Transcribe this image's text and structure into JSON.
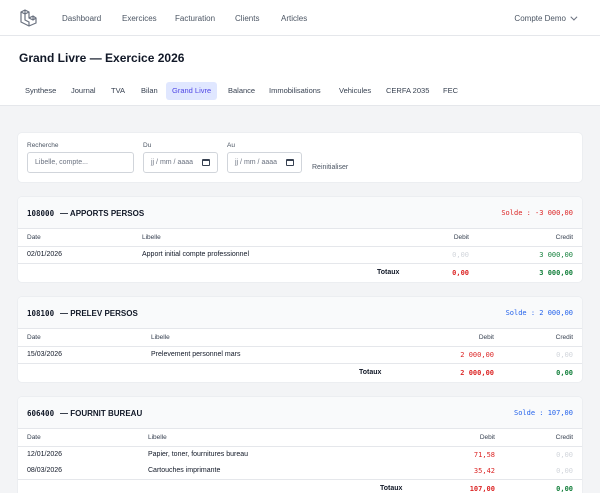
{
  "nav": {
    "items": [
      "Dashboard",
      "Exercices",
      "Facturation",
      "Clients",
      "Articles"
    ],
    "account_label": "Compte Demo"
  },
  "page": {
    "title": "Grand Livre — Exercice 2026"
  },
  "tabs": [
    "Synthese",
    "Journal",
    "TVA",
    "Bilan",
    "Grand Livre",
    "Balance",
    "Immobilisations",
    "Vehicules",
    "CERFA 2035",
    "FEC"
  ],
  "active_tab": "Grand Livre",
  "filters": {
    "search_label": "Recherche",
    "search_placeholder": "Libelle, compte...",
    "from_label": "Du",
    "from_value": "jj / mm / aaaa",
    "to_label": "Au",
    "to_value": "jj / mm / aaaa",
    "reset_label": "Reinitialiser"
  },
  "table_headers": {
    "date": "Date",
    "label": "Libelle",
    "debit": "Debit",
    "credit": "Credit",
    "totals": "Totaux"
  },
  "accounts": [
    {
      "code": "108000",
      "name": "— APPORTS PERSOS",
      "solde": "Solde : -3 000,00",
      "rows": [
        {
          "date": "02/01/2026",
          "label": "Apport initial compte professionnel",
          "debit": "0,00",
          "credit": "3 000,00"
        }
      ],
      "total_debit": "0,00",
      "total_credit": "3 000,00"
    },
    {
      "code": "108100",
      "name": "— PRELEV PERSOS",
      "solde": "Solde : 2 000,00",
      "rows": [
        {
          "date": "15/03/2026",
          "label": "Prelevement personnel mars",
          "debit": "2 000,00",
          "credit": "0,00"
        }
      ],
      "total_debit": "2 000,00",
      "total_credit": "0,00"
    },
    {
      "code": "606400",
      "name": "— FOURNIT BUREAU",
      "solde": "Solde : 107,00",
      "rows": [
        {
          "date": "12/01/2026",
          "label": "Papier, toner, fournitures bureau",
          "debit": "71,58",
          "credit": "0,00"
        },
        {
          "date": "08/03/2026",
          "label": "Cartouches imprimante",
          "debit": "35,42",
          "credit": "0,00"
        }
      ],
      "total_debit": "107,00",
      "total_credit": "0,00"
    }
  ],
  "colors": {
    "accent": "#4f46e5",
    "active_tab_bg": "#e0e7ff",
    "debit": "#dc2626",
    "credit": "#15803d",
    "solde_positive": "#2563eb"
  }
}
